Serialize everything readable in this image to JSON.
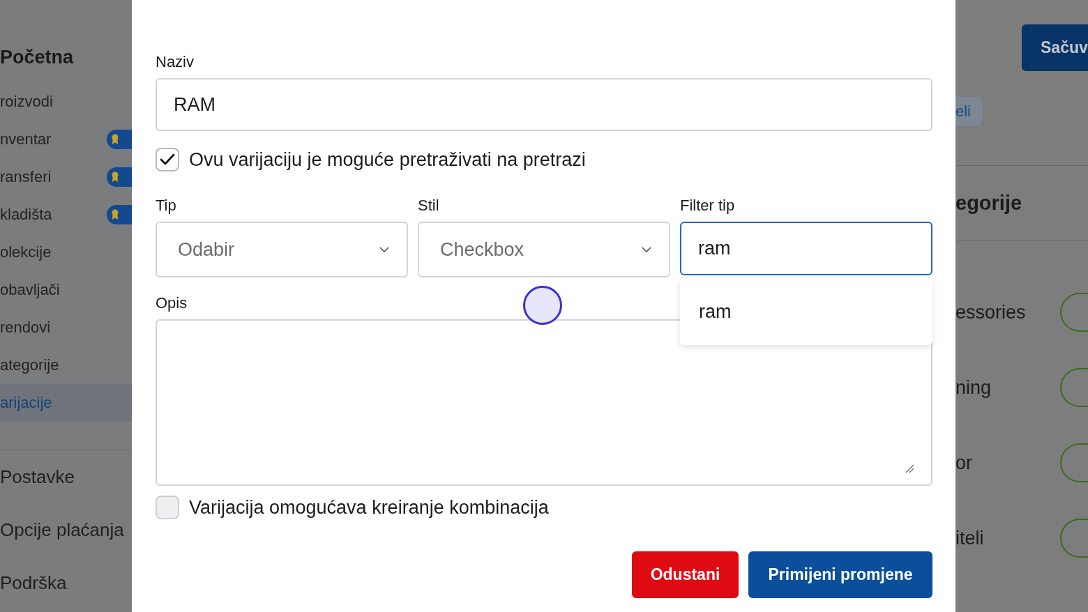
{
  "sidebar": {
    "home": "Početna",
    "items": [
      {
        "label": "roizvodi",
        "badge": false,
        "selected": false
      },
      {
        "label": "nventar",
        "badge": true,
        "selected": false
      },
      {
        "label": "ransferi",
        "badge": true,
        "selected": false
      },
      {
        "label": "kladišta",
        "badge": true,
        "selected": false
      },
      {
        "label": "olekcije",
        "badge": false,
        "selected": false
      },
      {
        "label": "obavljači",
        "badge": false,
        "selected": false
      },
      {
        "label": "rendovi",
        "badge": false,
        "selected": false
      },
      {
        "label": "ategorije",
        "badge": false,
        "selected": false
      },
      {
        "label": "arijacije",
        "badge": false,
        "selected": true
      }
    ],
    "sections": [
      "Postavke",
      "Opcije plaćanja",
      "Podrška"
    ]
  },
  "dialog": {
    "name": {
      "label": "Naziv",
      "value": "RAM"
    },
    "searchable": {
      "label": "Ovu varijaciju je moguće pretraživati na pretrazi",
      "checked": true
    },
    "type": {
      "label": "Tip",
      "value": "Odabir"
    },
    "style": {
      "label": "Stil",
      "value": "Checkbox"
    },
    "filter_type": {
      "label": "Filter tip",
      "value": "ram",
      "suggestions": [
        "ram"
      ]
    },
    "description": {
      "label": "Opis"
    },
    "combinations": {
      "label": "Varijacija omogućava kreiranje kombinacija",
      "checked": false
    },
    "buttons": {
      "cancel": "Odustani",
      "apply": "Primijeni promjene"
    }
  },
  "right_panel": {
    "save": "Sačuv",
    "chip": "eli",
    "heading": "egorije",
    "rows": [
      "essories",
      "ning",
      "or",
      "iteli"
    ]
  }
}
